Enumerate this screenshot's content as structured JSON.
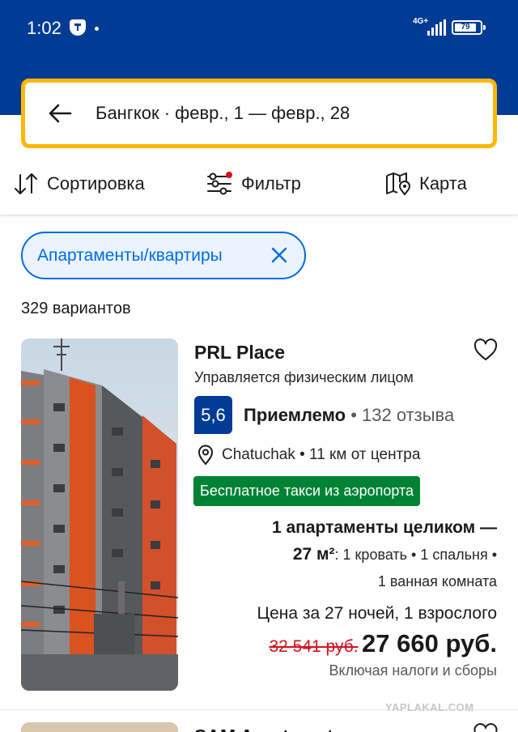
{
  "status_bar": {
    "time": "1:02",
    "network": "4G+",
    "battery": "79"
  },
  "search": {
    "query": "Бангкок · февр., 1 — февр., 28"
  },
  "toolbar": {
    "sort_label": "Сортировка",
    "filter_label": "Фильтр",
    "map_label": "Карта"
  },
  "filter_chip": {
    "label": "Апартаменты/квартиры"
  },
  "results": {
    "count_label": "329 вариантов"
  },
  "listing": {
    "name": "PRL Place",
    "managed_by": "Управляется физическим лицом",
    "score": "5,6",
    "rating_word": "Приемлемо",
    "separator": "•",
    "reviews": "132 отзыва",
    "location": "Chatuchak • 11 км от центра",
    "badge": "Бесплатное такси из аэропорта",
    "unit_line1": "1 апартаменты целиком —",
    "unit_size": "27 м²",
    "unit_line2": ": 1 кровать • 1 спальня •",
    "unit_line3": "1 ванная комната",
    "price_for": "Цена за 27 ночей, 1 взрослого",
    "old_price": "32 541 руб.",
    "new_price": "27 660 руб.",
    "taxes": "Включая налоги и сборы"
  },
  "next_listing": {
    "name": "SAM Apartment"
  },
  "watermark": "YAPLAKAL.COM",
  "colors": {
    "brand_blue": "#003b95",
    "search_border": "#ffb700",
    "chip_blue": "#006ce4",
    "badge_green": "#008234",
    "old_price_red": "#d4111e"
  }
}
